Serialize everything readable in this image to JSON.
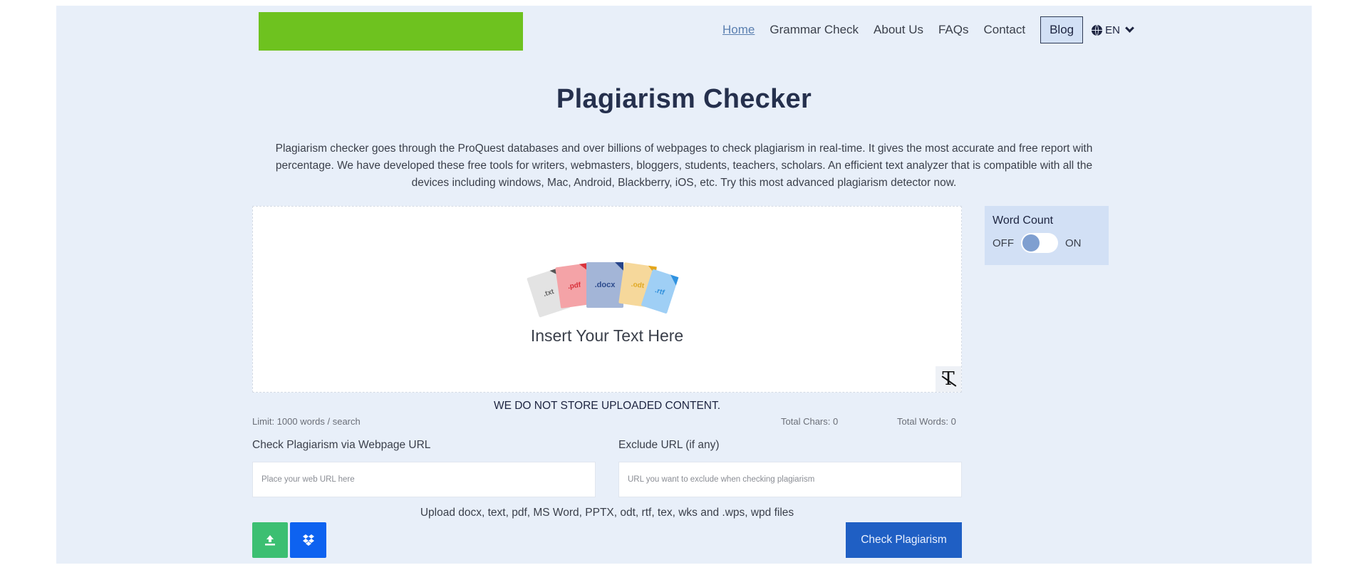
{
  "header": {
    "logo_color": "#6ec21f",
    "nav": [
      {
        "label": "Home",
        "active": true
      },
      {
        "label": "Grammar Check"
      },
      {
        "label": "About Us"
      },
      {
        "label": "FAQs"
      },
      {
        "label": "Contact"
      }
    ],
    "blog_label": "Blog",
    "language": {
      "icon": "globe-icon",
      "value": "EN"
    }
  },
  "main": {
    "title": "Plagiarism Checker",
    "description": "Plagiarism checker goes through the ProQuest databases and over billions of webpages to check plagiarism in real-time. It gives the most accurate and free report with percentage. We have developed these free tools for writers, webmasters, bloggers, students, teachers, scholars. An efficient text analyzer that is compatible with all the devices including windows, Mac, Android, Blackberry, iOS, etc. Try this most advanced plagiarism detector now.",
    "editor": {
      "file_types": [
        ".txt",
        ".pdf",
        ".docx",
        ".odt",
        ".rtf"
      ],
      "placeholder": "Insert Your Text Here",
      "clear_format_icon": "clear-format-icon"
    },
    "notice": "WE DO NOT STORE UPLOADED CONTENT.",
    "limit": "Limit: 1000 words / search",
    "total_chars": "Total Chars: 0",
    "total_words": "Total Words: 0",
    "url_label": "Check Plagiarism via Webpage URL",
    "url_placeholder": "Place your web URL here",
    "exclude_label": "Exclude URL (if any)",
    "exclude_placeholder": "URL you want to exclude when checking plagiarism",
    "upload_note": "Upload docx, text, pdf, MS Word, PPTX, odt, rtf, tex, wks and .wps, wpd files",
    "upload_icon": "upload-icon",
    "dropbox_icon": "dropbox-icon",
    "check_button": "Check Plagiarism"
  },
  "word_count": {
    "title": "Word Count",
    "off_label": "OFF",
    "on_label": "ON",
    "enabled": false
  }
}
